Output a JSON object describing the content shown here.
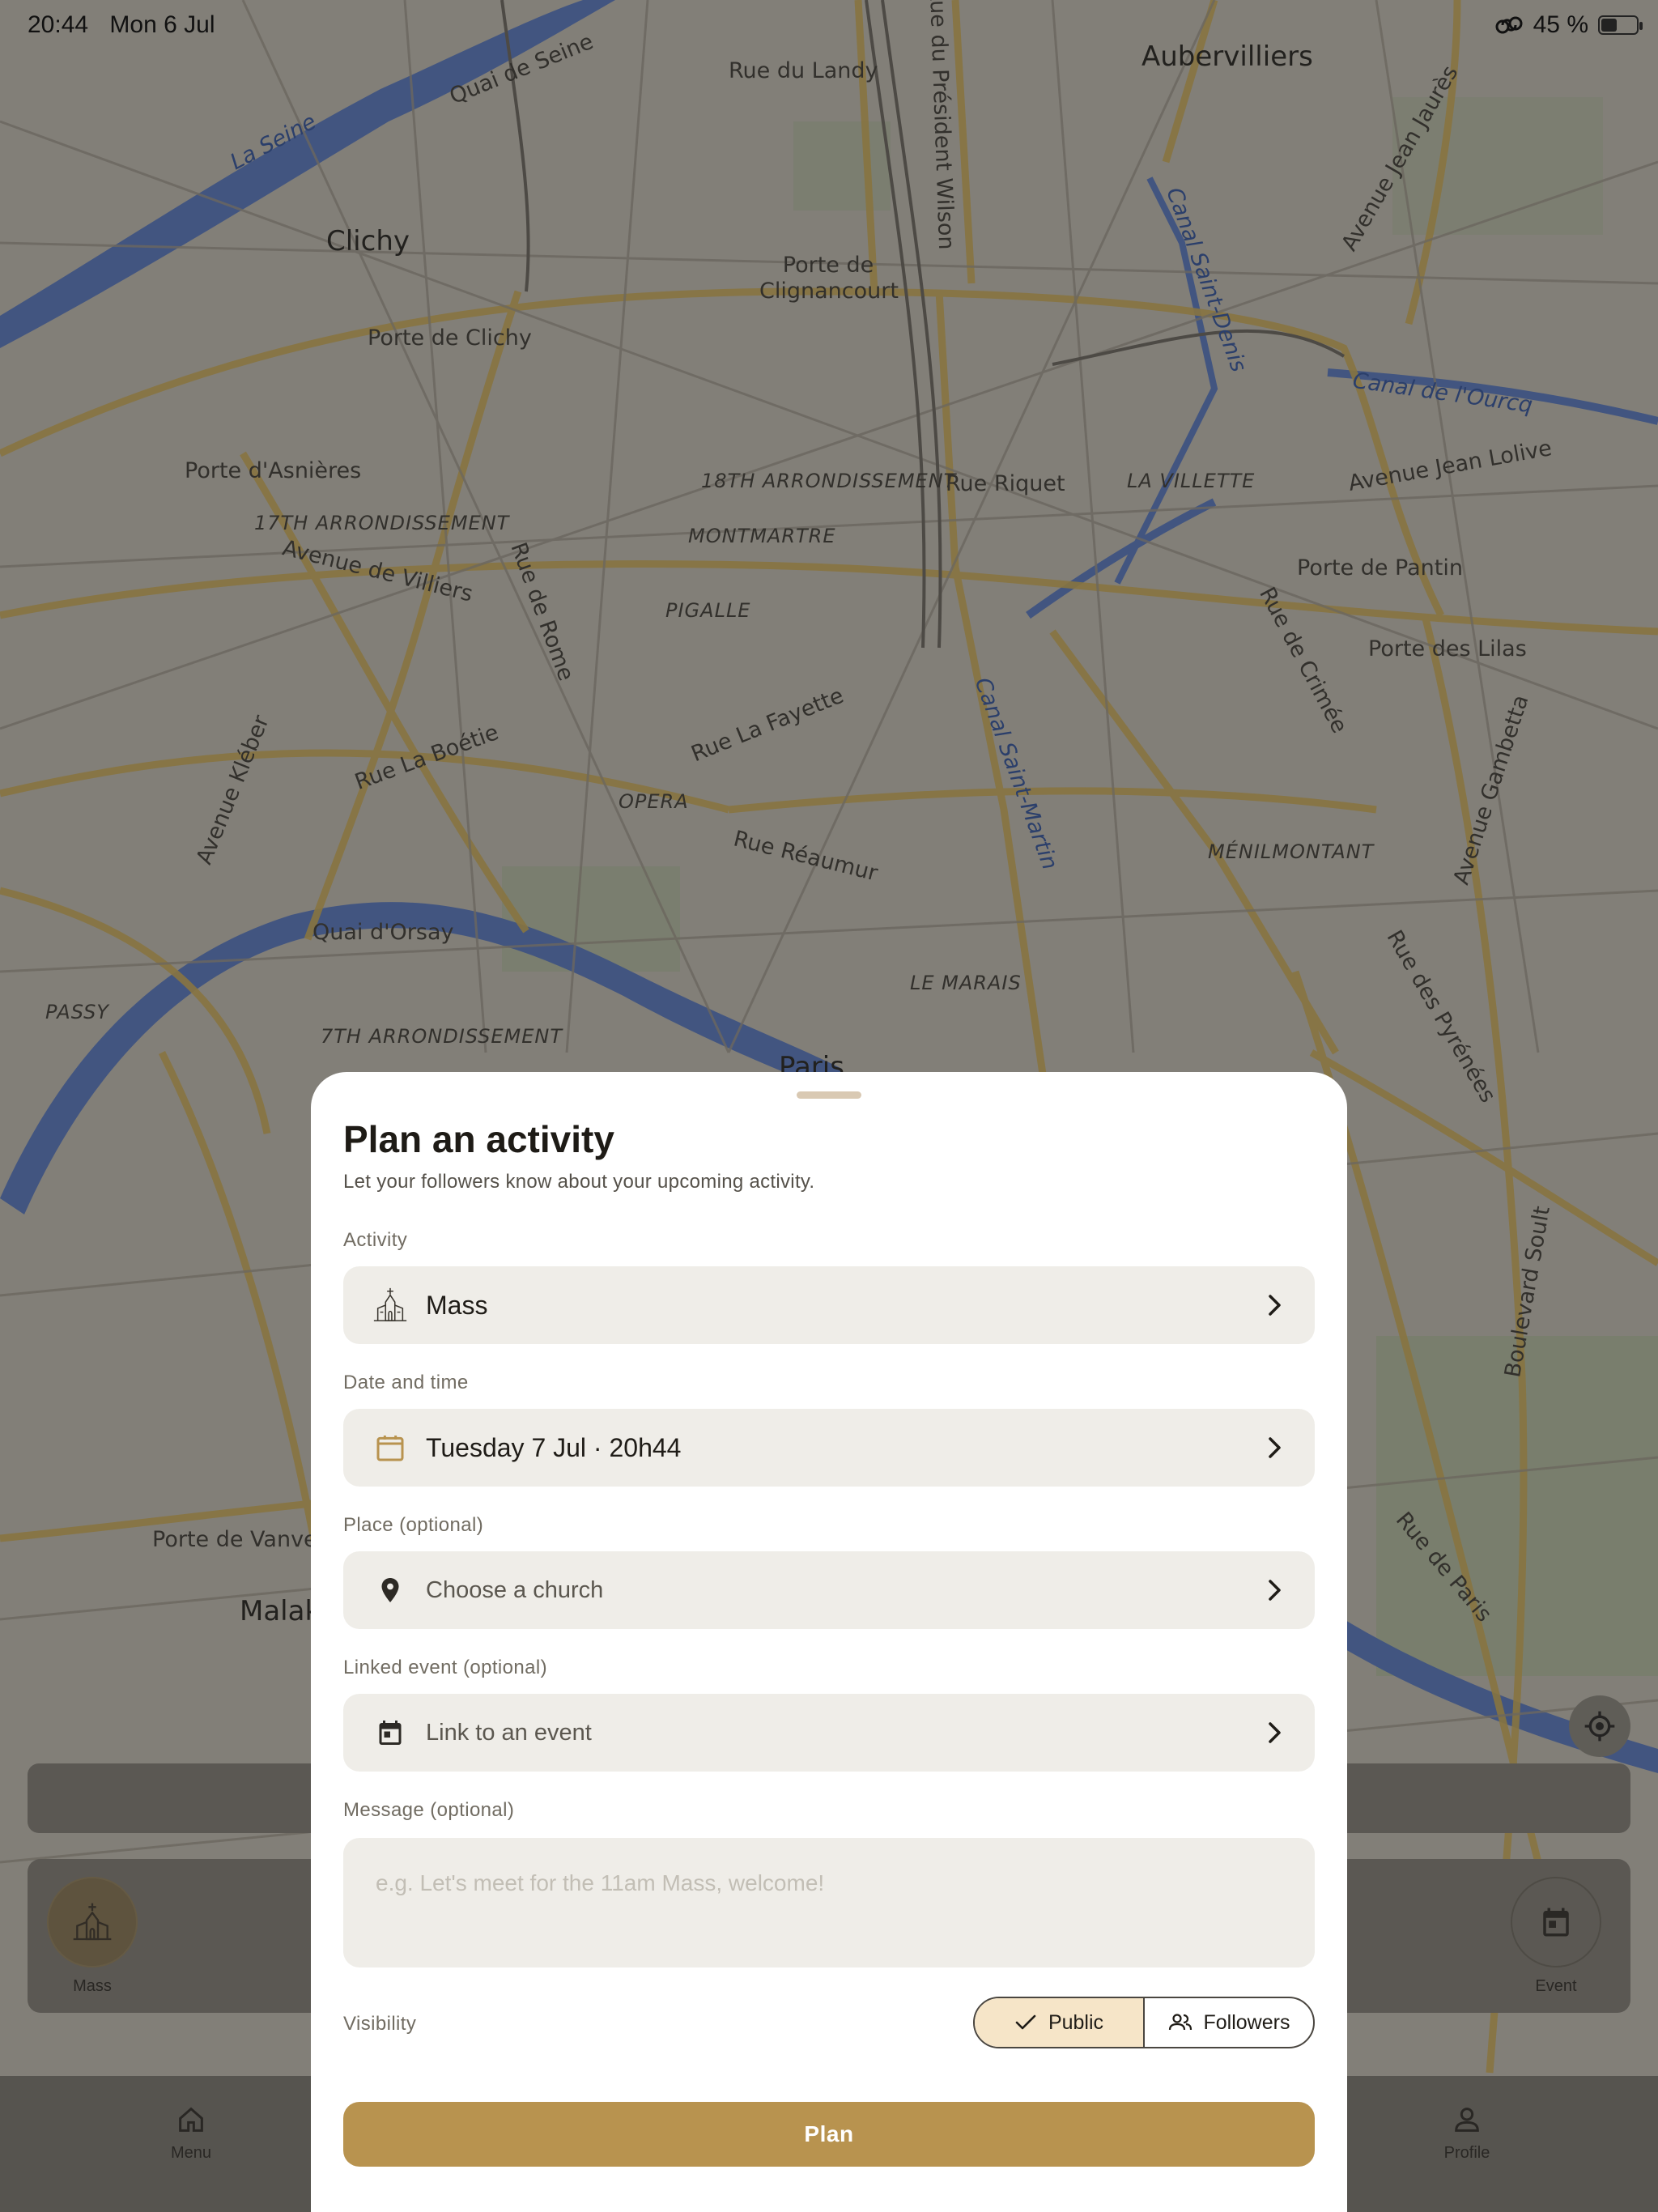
{
  "status_bar": {
    "time": "20:44",
    "date": "Mon 6 Jul",
    "battery": "45 %",
    "battery_level": 0.45
  },
  "map": {
    "labels": [
      "Rue du Landy",
      "Aubervilliers",
      "Quai de Seine",
      "Clichy",
      "Porte de Clignancourt",
      "Porte de Clichy",
      "Canal Saint-Denis",
      "Canal de l'Ourcq",
      "Porte d'Asnières",
      "18TH ARRONDISSEMENT",
      "Rue Riquet",
      "LA VILLETTE",
      "Avenue Jean Lolive",
      "17TH ARRONDISSEMENT",
      "MONTMARTRE",
      "Porte de Pantin",
      "Avenue de Villiers",
      "PIGALLE",
      "Porte des Lilas",
      "Rue de Rome",
      "Rue La Fayette",
      "Rue La Boétie",
      "OPERA",
      "Rue Réaumur",
      "MÉNILMONTANT",
      "Avenue Kléber",
      "Quai d'Orsay",
      "Canal Saint-Martin",
      "LE MARAIS",
      "PASSY",
      "7TH ARRONDISSEMENT",
      "Paris",
      "Rue de Crimée",
      "Avenue Gambetta",
      "Rue des Pyrénées",
      "Boulevard Soult",
      "Porte de Vanves",
      "Malakoff",
      "Rue de Paris",
      "La Seine",
      "Rue du Président Wilson",
      "Avenue Jean Jaurès"
    ]
  },
  "background": {
    "quick_actions": [
      {
        "label": "Mass",
        "icon": "church-icon"
      },
      {
        "label": "Event",
        "icon": "calendar-icon"
      }
    ],
    "tabs": [
      {
        "label": "Menu",
        "icon": "home-icon"
      },
      {
        "label": "Profile",
        "icon": "profile-icon"
      }
    ]
  },
  "sheet": {
    "title": "Plan an activity",
    "subtitle": "Let your followers know about your upcoming activity.",
    "activity": {
      "label": "Activity",
      "value": "Mass",
      "icon": "church-icon"
    },
    "datetime": {
      "label": "Date and time",
      "value": "Tuesday 7 Jul · 20h44",
      "icon": "calendar-icon"
    },
    "place": {
      "label": "Place (optional)",
      "placeholder": "Choose a church",
      "icon": "location-pin-icon"
    },
    "linked_event": {
      "label": "Linked event (optional)",
      "placeholder": "Link to an event",
      "icon": "event-calendar-icon"
    },
    "message": {
      "label": "Message (optional)",
      "placeholder": "e.g. Let's meet for the 11am Mass, welcome!"
    },
    "visibility": {
      "label": "Visibility",
      "options": [
        {
          "label": "Public",
          "selected": true,
          "icon": "check-icon"
        },
        {
          "label": "Followers",
          "selected": false,
          "icon": "people-icon"
        }
      ]
    },
    "submit_label": "Plan",
    "colors": {
      "accent": "#b8934f",
      "selected_segment": "#f6e5c8",
      "field_bg": "#efede8"
    }
  }
}
